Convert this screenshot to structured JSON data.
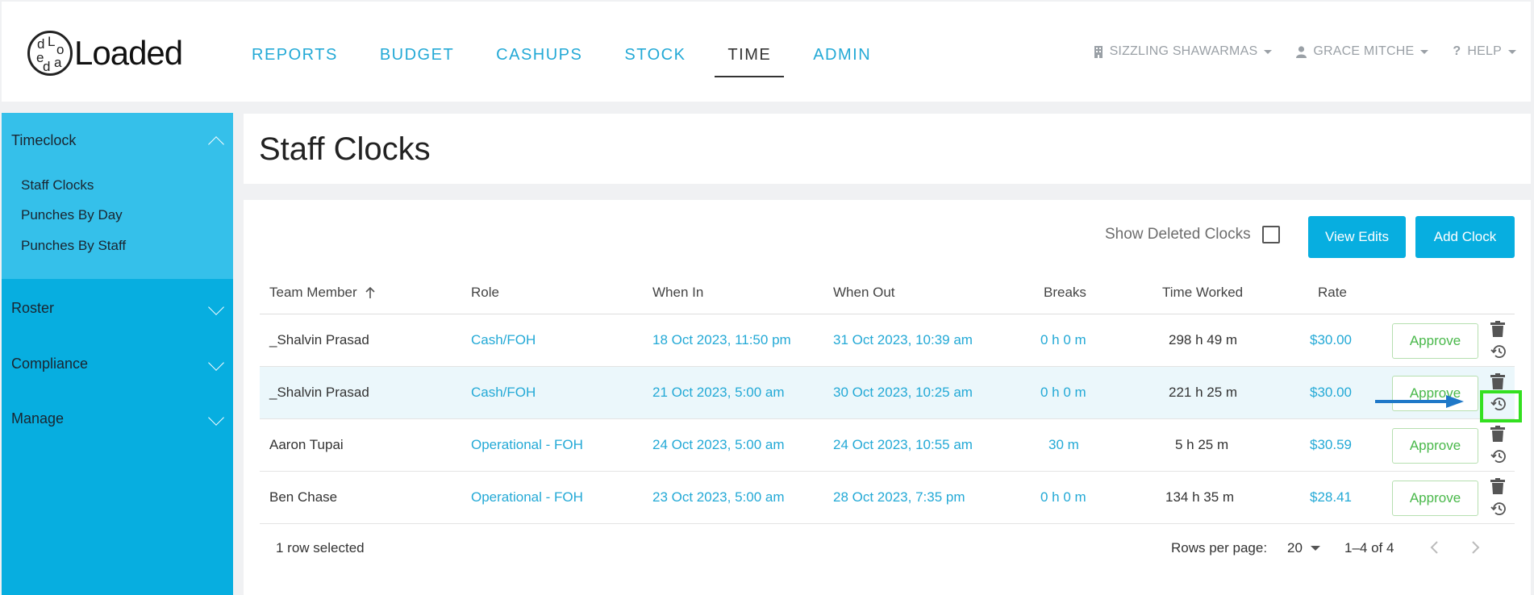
{
  "brand": {
    "logo_text": "Loaded",
    "logo_mark_letters": [
      "d",
      "L",
      "o",
      "e",
      "d",
      "a"
    ]
  },
  "nav": [
    {
      "label": "REPORTS"
    },
    {
      "label": "BUDGET"
    },
    {
      "label": "CASHUPS"
    },
    {
      "label": "STOCK"
    },
    {
      "label": "TIME",
      "active": true
    },
    {
      "label": "ADMIN"
    }
  ],
  "top_right": {
    "store": "SIZZLING SHAWARMAS",
    "user": "GRACE MITCHE",
    "help": "HELP"
  },
  "sidebar": {
    "section_title": "Timeclock",
    "items": [
      {
        "label": "Staff Clocks"
      },
      {
        "label": "Punches By Day"
      },
      {
        "label": "Punches By Staff"
      }
    ],
    "sections": [
      {
        "label": "Roster"
      },
      {
        "label": "Compliance"
      },
      {
        "label": "Manage"
      }
    ]
  },
  "page": {
    "title": "Staff Clocks"
  },
  "toolbar": {
    "show_deleted_label": "Show Deleted Clocks",
    "view_edits_label": "View Edits",
    "add_clock_label": "Add Clock"
  },
  "table": {
    "headers": [
      "Team Member",
      "Role",
      "When In",
      "When Out",
      "Breaks",
      "Time Worked",
      "Rate"
    ],
    "sort_icon": "arrow-up-icon",
    "rows": [
      {
        "member": "_Shalvin Prasad",
        "role": "Cash/FOH",
        "when_in": "18 Oct 2023, 11:50 pm",
        "when_out": "31 Oct 2023, 10:39 am",
        "breaks": "0 h 0 m",
        "time_worked": "298 h 49 m",
        "rate": "$30.00",
        "action": "Approve",
        "selected": false
      },
      {
        "member": "_Shalvin Prasad",
        "role": "Cash/FOH",
        "when_in": "21 Oct 2023, 5:00 am",
        "when_out": "30 Oct 2023, 10:25 am",
        "breaks": "0 h 0 m",
        "time_worked": "221 h 25 m",
        "rate": "$30.00",
        "action": "Approve",
        "selected": true
      },
      {
        "member": "Aaron Tupai",
        "role": "Operational - FOH",
        "when_in": "24 Oct 2023, 5:00 am",
        "when_out": "24 Oct 2023, 10:55 am",
        "breaks": "30 m",
        "time_worked": "5 h 25 m",
        "rate": "$30.59",
        "action": "Approve",
        "selected": false
      },
      {
        "member": "Ben Chase",
        "role": "Operational - FOH",
        "when_in": "23 Oct 2023, 5:00 am",
        "when_out": "28 Oct 2023, 7:35 pm",
        "breaks": "0 h 0 m",
        "time_worked": "134 h 35 m",
        "rate": "$28.41",
        "action": "Approve",
        "selected": false
      }
    ]
  },
  "footer": {
    "selection": "1 row selected",
    "rows_per_page_label": "Rows per page:",
    "rows_per_page_value": "20",
    "range": "1–4 of 4"
  },
  "colors": {
    "accent": "#07aee0",
    "link": "#23a9d6",
    "approve": "#49b84a",
    "highlight": "#33e020",
    "annotation_arrow": "#1f78c8"
  }
}
